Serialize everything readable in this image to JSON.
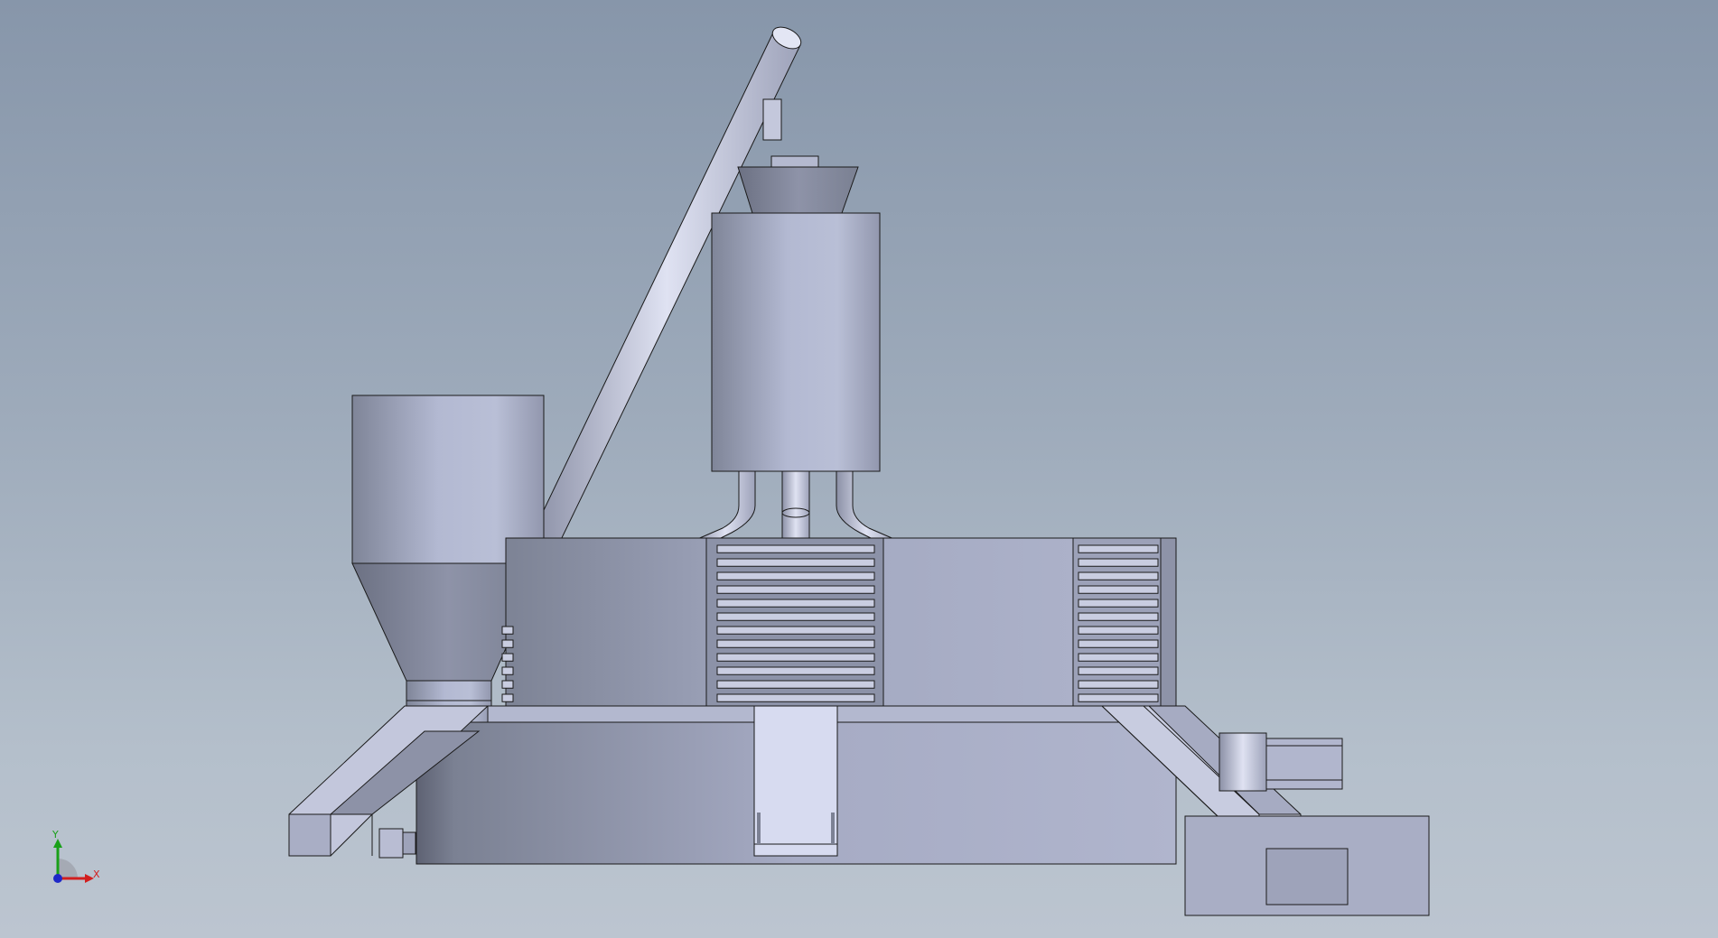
{
  "viewport": {
    "background_top": "#8796aa",
    "background_bottom": "#bcc5d0"
  },
  "model": {
    "icon": "cad-machine-assembly-side-view",
    "face_light": "#d5d9ef",
    "face_mid": "#aab0cc",
    "face_dark": "#7d8397",
    "edge": "#1a1a1a"
  },
  "triad": {
    "icon": "coordinate-triad-icon",
    "x_label": "X",
    "y_label": "Y",
    "x_color": "#d21e1e",
    "y_color": "#19a019",
    "z_color": "#1e28c8"
  }
}
